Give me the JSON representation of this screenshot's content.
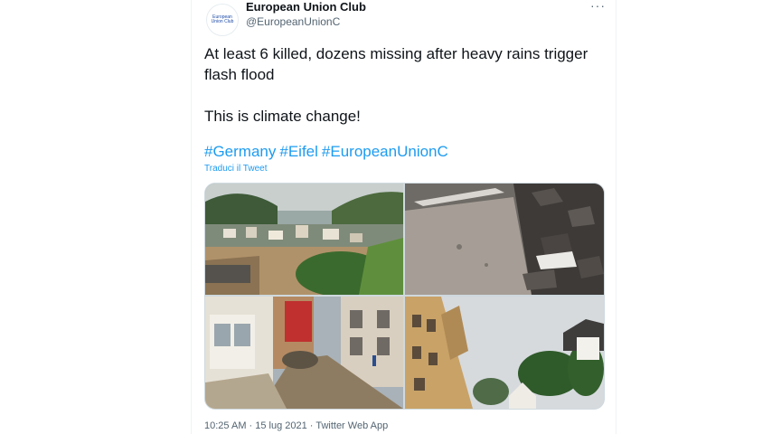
{
  "account": {
    "name": "European Union Club",
    "handle": "@EuropeanUnionC",
    "avatar_text": "European Union Club"
  },
  "tweet": {
    "line1": "At least 6 killed, dozens missing after heavy rains trigger flash flood",
    "line2": "This is climate change!",
    "hashtags": [
      "#Germany",
      "#Eifel",
      "#EuropeanUnionC"
    ],
    "translate": "Traduci il Tweet",
    "timestamp": "10:25 AM · 15 lug 2021 · Twitter Web App"
  },
  "icons": {
    "more": "more-dots-icon"
  },
  "colors": {
    "link": "#1d9bf0",
    "text": "#0f1419",
    "muted": "#536471",
    "border": "#eff3f4"
  }
}
